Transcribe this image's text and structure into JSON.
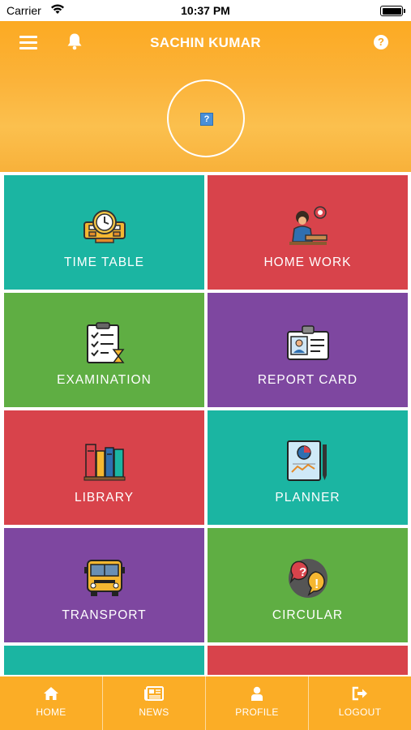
{
  "status_bar": {
    "carrier": "Carrier",
    "time": "10:37 PM"
  },
  "header": {
    "title": "SACHIN KUMAR",
    "help_symbol": "?",
    "avatar_placeholder": "?"
  },
  "colors": {
    "accent": "#fbad26",
    "teal": "#1bb5a2",
    "red": "#d8434b",
    "green": "#5fae43",
    "purple": "#7e47a0"
  },
  "tiles": [
    {
      "label": "TIME TABLE",
      "icon": "clock-icon",
      "color": "#1bb5a2"
    },
    {
      "label": "HOME WORK",
      "icon": "student-studying-icon",
      "color": "#d8434b"
    },
    {
      "label": "EXAMINATION",
      "icon": "clipboard-checklist-icon",
      "color": "#5fae43"
    },
    {
      "label": "REPORT CARD",
      "icon": "id-card-icon",
      "color": "#7e47a0"
    },
    {
      "label": "LIBRARY",
      "icon": "books-icon",
      "color": "#d8434b"
    },
    {
      "label": "PLANNER",
      "icon": "planner-chart-icon",
      "color": "#1bb5a2"
    },
    {
      "label": "TRANSPORT",
      "icon": "school-bus-icon",
      "color": "#7e47a0"
    },
    {
      "label": "CIRCULAR",
      "icon": "speech-bubbles-icon",
      "color": "#5fae43"
    },
    {
      "label": "",
      "icon": "book-icon",
      "color": "#1bb5a2"
    },
    {
      "label": "",
      "icon": "",
      "color": "#d8434b"
    }
  ],
  "bottom_nav": [
    {
      "label": "HOME",
      "icon": "home-icon"
    },
    {
      "label": "NEWS",
      "icon": "newspaper-icon"
    },
    {
      "label": "PROFILE",
      "icon": "user-icon"
    },
    {
      "label": "LOGOUT",
      "icon": "logout-icon"
    }
  ]
}
